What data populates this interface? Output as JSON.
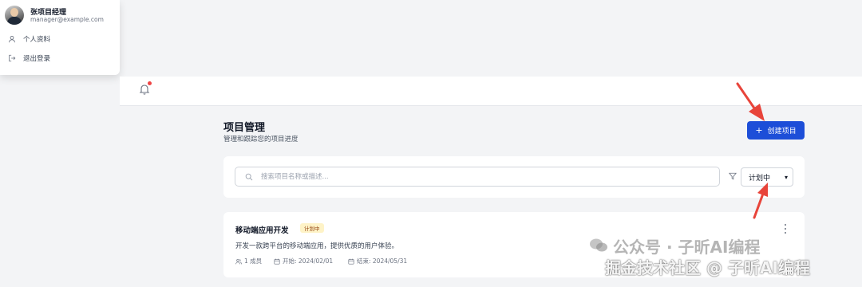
{
  "user": {
    "name": "张项目经理",
    "email": "manager@example.com",
    "menu": [
      {
        "label": "个人资料",
        "icon": "user-icon"
      },
      {
        "label": "退出登录",
        "icon": "logout-icon"
      }
    ]
  },
  "header": {
    "notification_icon": "bell-icon",
    "has_unread": true
  },
  "page": {
    "title": "项目管理",
    "subtitle": "管理和跟踪您的项目进度",
    "create_label": "创建项目"
  },
  "filters": {
    "search_placeholder": "搜索项目名称或描述...",
    "status_selected": "计划中"
  },
  "projects": [
    {
      "name": "移动端应用开发",
      "status": "计划中",
      "description": "开发一款跨平台的移动端应用，提供优质的用户体验。",
      "members": "1 成员",
      "start": "开始: 2024/02/01",
      "end": "结束: 2024/05/31"
    }
  ],
  "watermark": {
    "line1": "公众号 · 子昕AI编程",
    "line2": "掘金技术社区 @ 子昕AI编程"
  },
  "colors": {
    "primary": "#1d4ed8",
    "badge_bg": "#fef3c7",
    "badge_text": "#92400e",
    "annotation": "#e8443a",
    "notification_dot": "#ef4444"
  }
}
